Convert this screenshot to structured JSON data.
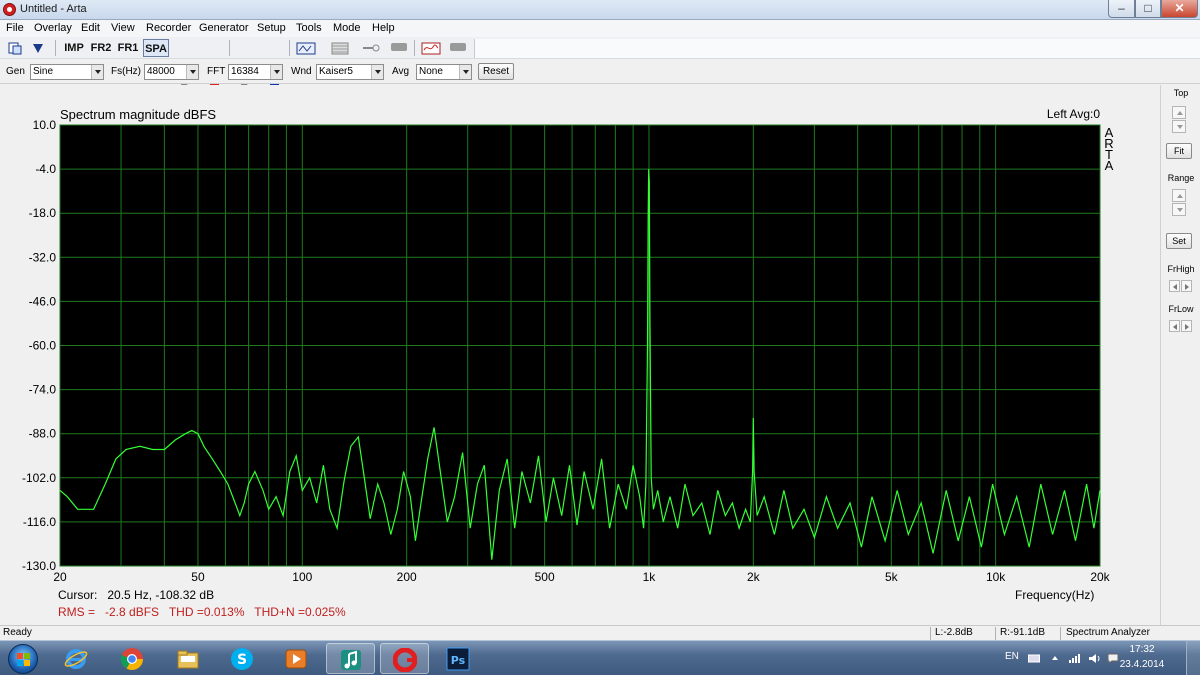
{
  "window": {
    "title": "Untitled - Arta",
    "minimize": "–",
    "maximize": "□",
    "close": "✕"
  },
  "menu": [
    "File",
    "Overlay",
    "Edit",
    "View",
    "Recorder",
    "Generator",
    "Setup",
    "Tools",
    "Mode",
    "Help"
  ],
  "toolbar": {
    "imp": "IMP",
    "fr2": "FR2",
    "fr1": "FR1",
    "spa": "SPA",
    "active_mode": "SPA"
  },
  "settings": {
    "gen_label": "Gen",
    "gen_value": "Sine",
    "fs_label": "Fs(Hz)",
    "fs_value": "48000",
    "fft_label": "FFT",
    "fft_value": "16384",
    "wnd_label": "Wnd",
    "wnd_value": "Kaiser5",
    "avg_label": "Avg",
    "avg_value": "None",
    "reset": "Reset"
  },
  "right_panel": {
    "top": "Top",
    "fit": "Fit",
    "range": "Range",
    "set": "Set",
    "frhigh": "FrHigh",
    "frlow": "FrLow"
  },
  "chart_data": {
    "type": "line",
    "title": "Spectrum magnitude dBFS",
    "channel_info": "Left  Avg:0",
    "brand": [
      "A",
      "R",
      "T",
      "A"
    ],
    "xlabel": "Frequency(Hz)",
    "ylabel": "",
    "xscale": "log",
    "xlim": [
      20,
      20000
    ],
    "ylim": [
      -130,
      10
    ],
    "y_ticks": [
      "10.0",
      "-4.0",
      "-18.0",
      "-32.0",
      "-46.0",
      "-60.0",
      "-74.0",
      "-88.0",
      "-102.0",
      "-116.0",
      "-130.0"
    ],
    "x_ticks": [
      {
        "v": 20,
        "label": "20"
      },
      {
        "v": 50,
        "label": "50"
      },
      {
        "v": 100,
        "label": "100"
      },
      {
        "v": 200,
        "label": "200"
      },
      {
        "v": 500,
        "label": "500"
      },
      {
        "v": 1000,
        "label": "1k"
      },
      {
        "v": 2000,
        "label": "2k"
      },
      {
        "v": 5000,
        "label": "5k"
      },
      {
        "v": 10000,
        "label": "10k"
      },
      {
        "v": 20000,
        "label": "20k"
      }
    ],
    "grid": true,
    "background": "#000000",
    "grid_color": "#1f7a1f",
    "trace_color": "#33ff33",
    "series": [
      {
        "points": [
          [
            20,
            -106
          ],
          [
            21,
            -108
          ],
          [
            22.5,
            -112
          ],
          [
            25,
            -112
          ],
          [
            27,
            -104
          ],
          [
            29,
            -96
          ],
          [
            31,
            -93
          ],
          [
            34,
            -92
          ],
          [
            37,
            -93
          ],
          [
            40,
            -93
          ],
          [
            43,
            -90
          ],
          [
            46,
            -88
          ],
          [
            48,
            -87
          ],
          [
            50,
            -88
          ],
          [
            52,
            -92
          ],
          [
            55,
            -96
          ],
          [
            58,
            -100
          ],
          [
            61,
            -104
          ],
          [
            64,
            -110
          ],
          [
            66,
            -114
          ],
          [
            68,
            -110
          ],
          [
            70,
            -104
          ],
          [
            73,
            -100
          ],
          [
            77,
            -106
          ],
          [
            80,
            -112
          ],
          [
            84,
            -108
          ],
          [
            88,
            -114
          ],
          [
            92,
            -100
          ],
          [
            96,
            -95
          ],
          [
            100,
            -106
          ],
          [
            105,
            -102
          ],
          [
            110,
            -110
          ],
          [
            115,
            -98
          ],
          [
            120,
            -112
          ],
          [
            126,
            -118
          ],
          [
            132,
            -103
          ],
          [
            138,
            -92
          ],
          [
            145,
            -89
          ],
          [
            150,
            -100
          ],
          [
            157,
            -115
          ],
          [
            165,
            -104
          ],
          [
            172,
            -110
          ],
          [
            180,
            -120
          ],
          [
            188,
            -112
          ],
          [
            196,
            -100
          ],
          [
            205,
            -108
          ],
          [
            212,
            -122
          ],
          [
            220,
            -110
          ],
          [
            230,
            -96
          ],
          [
            240,
            -86
          ],
          [
            250,
            -100
          ],
          [
            262,
            -116
          ],
          [
            275,
            -108
          ],
          [
            290,
            -94
          ],
          [
            305,
            -118
          ],
          [
            320,
            -104
          ],
          [
            335,
            -98
          ],
          [
            352,
            -128
          ],
          [
            370,
            -106
          ],
          [
            390,
            -96
          ],
          [
            410,
            -118
          ],
          [
            430,
            -100
          ],
          [
            455,
            -110
          ],
          [
            480,
            -95
          ],
          [
            505,
            -116
          ],
          [
            530,
            -102
          ],
          [
            560,
            -114
          ],
          [
            590,
            -98
          ],
          [
            620,
            -117
          ],
          [
            650,
            -100
          ],
          [
            690,
            -112
          ],
          [
            730,
            -96
          ],
          [
            770,
            -118
          ],
          [
            815,
            -104
          ],
          [
            860,
            -112
          ],
          [
            900,
            -98
          ],
          [
            940,
            -108
          ],
          [
            965,
            -118
          ],
          [
            980,
            -104
          ],
          [
            990,
            -60
          ],
          [
            995,
            -18
          ],
          [
            998,
            -4
          ],
          [
            1002,
            -8
          ],
          [
            1006,
            -50
          ],
          [
            1015,
            -102
          ],
          [
            1030,
            -112
          ],
          [
            1060,
            -106
          ],
          [
            1100,
            -116
          ],
          [
            1150,
            -108
          ],
          [
            1210,
            -118
          ],
          [
            1270,
            -104
          ],
          [
            1340,
            -114
          ],
          [
            1420,
            -110
          ],
          [
            1500,
            -120
          ],
          [
            1580,
            -106
          ],
          [
            1660,
            -114
          ],
          [
            1740,
            -110
          ],
          [
            1820,
            -118
          ],
          [
            1900,
            -112
          ],
          [
            1960,
            -116
          ],
          [
            1990,
            -100
          ],
          [
            2000,
            -83
          ],
          [
            2010,
            -100
          ],
          [
            2050,
            -114
          ],
          [
            2150,
            -108
          ],
          [
            2300,
            -120
          ],
          [
            2450,
            -106
          ],
          [
            2600,
            -118
          ],
          [
            2800,
            -112
          ],
          [
            3000,
            -121
          ],
          [
            3250,
            -108
          ],
          [
            3500,
            -118
          ],
          [
            3800,
            -110
          ],
          [
            4100,
            -124
          ],
          [
            4400,
            -108
          ],
          [
            4800,
            -122
          ],
          [
            5200,
            -106
          ],
          [
            5600,
            -120
          ],
          [
            6100,
            -110
          ],
          [
            6600,
            -126
          ],
          [
            7200,
            -106
          ],
          [
            7800,
            -122
          ],
          [
            8400,
            -108
          ],
          [
            9100,
            -124
          ],
          [
            9800,
            -104
          ],
          [
            10600,
            -120
          ],
          [
            11500,
            -108
          ],
          [
            12500,
            -124
          ],
          [
            13500,
            -104
          ],
          [
            14600,
            -120
          ],
          [
            15800,
            -106
          ],
          [
            17000,
            -122
          ],
          [
            18300,
            -104
          ],
          [
            19200,
            -118
          ],
          [
            20000,
            -106
          ]
        ]
      }
    ],
    "cursor": "Cursor:   20.5 Hz, -108.32 dB",
    "measurements": "RMS =   -2.8 dBFS   THD =0.013%   THD+N =0.025%"
  },
  "status": {
    "left": "Ready",
    "l_level": "L:-2.8dB",
    "r_level": "R:-91.1dB",
    "mode": "Spectrum Analyzer"
  },
  "taskbar": {
    "lang": "EN",
    "time": "17:32",
    "date": "23.4.2014"
  }
}
